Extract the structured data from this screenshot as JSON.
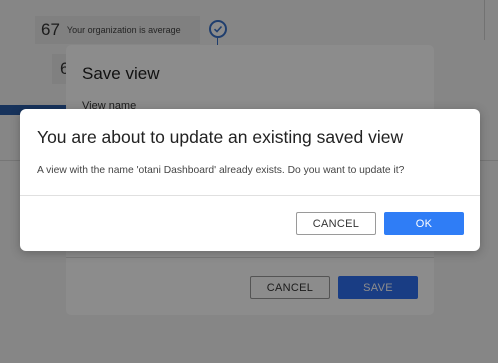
{
  "background": {
    "score_card": {
      "value": "67",
      "label": "Your organization is average"
    },
    "score_card_2": {
      "value": "6"
    },
    "status_icon": "check-circle-icon"
  },
  "save_view_dialog": {
    "title": "Save view",
    "view_name_label": "View name",
    "cancel_label": "CANCEL",
    "save_label": "SAVE"
  },
  "confirm_modal": {
    "title": "You are about to update an existing saved view",
    "message": "A view with the name 'otani Dashboard' already exists. Do you want to update it?",
    "cancel_label": "CANCEL",
    "ok_label": "OK"
  },
  "colors": {
    "primary_button": "#2f7df6",
    "overlay": "rgba(0,0,0,0.45)",
    "accent_blue": "#3a72c8"
  }
}
